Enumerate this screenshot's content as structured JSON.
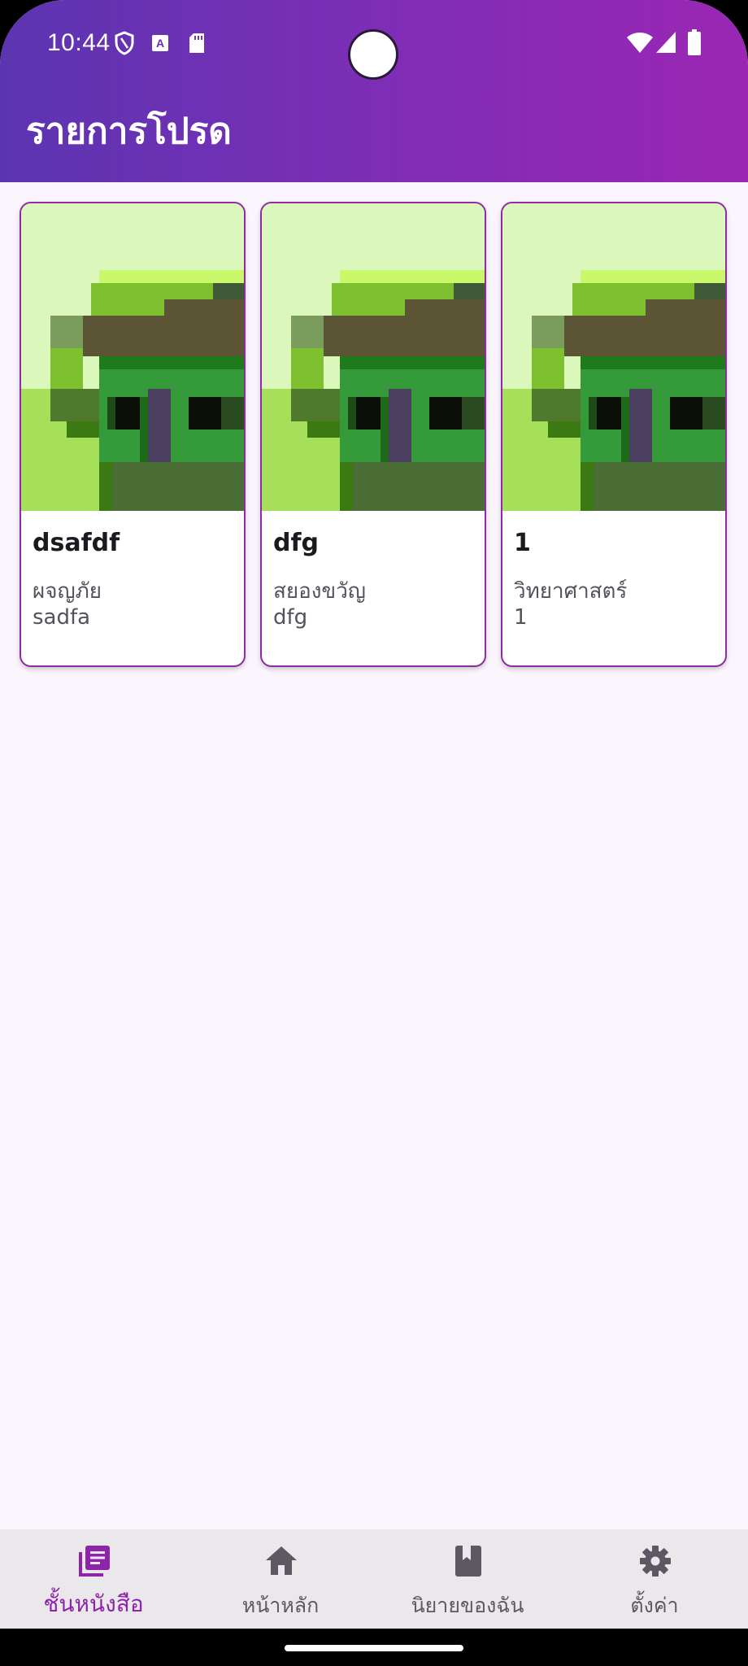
{
  "status_bar": {
    "time": "10:44",
    "icons_left": [
      "shield-icon",
      "keyboard-a-icon",
      "sd-card-icon"
    ],
    "icons_right": [
      "wifi-icon",
      "signal-icon",
      "battery-icon"
    ]
  },
  "header": {
    "title": "รายการโปรด"
  },
  "colors": {
    "header_gradient_start": "#5b35b1",
    "header_gradient_end": "#9b27b3",
    "accent": "#8e24aa",
    "background": "#fbf5fd"
  },
  "cards": [
    {
      "title": "dsafdf",
      "genre": "ผจญภัย",
      "subtitle": "sadfa",
      "image": "pixel-house-image"
    },
    {
      "title": "dfg",
      "genre": "สยองขวัญ",
      "subtitle": "dfg",
      "image": "pixel-house-image"
    },
    {
      "title": "1",
      "genre": "วิทยาศาสตร์",
      "subtitle": "1",
      "image": "pixel-house-image"
    }
  ],
  "bottom_nav": {
    "items": [
      {
        "label": "ชั้นหนังสือ",
        "icon": "library-books-icon",
        "active": true
      },
      {
        "label": "หน้าหลัก",
        "icon": "home-icon",
        "active": false
      },
      {
        "label": "นิยายของฉัน",
        "icon": "book-icon",
        "active": false
      },
      {
        "label": "ตั้งค่า",
        "icon": "gear-icon",
        "active": false
      }
    ]
  }
}
